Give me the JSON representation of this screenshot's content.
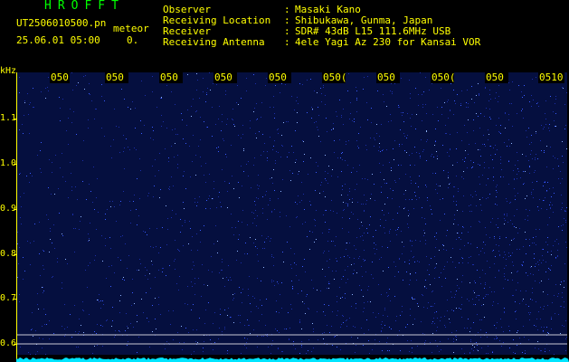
{
  "header": {
    "title": "HROFFT",
    "filename": "UT2506010500.pn",
    "meteor_label": "meteor",
    "datetime": "25.06.01 05:00",
    "count": "0."
  },
  "meta": [
    {
      "label": "Observer",
      "sep": ":",
      "value": "Masaki Kano"
    },
    {
      "label": "Receiving Location",
      "sep": ":",
      "value": "Shibukawa, Gunma, Japan"
    },
    {
      "label": "Receiver",
      "sep": ":",
      "value": "SDR# 43dB L15 111.6MHz USB"
    },
    {
      "label": "Receiving Antenna",
      "sep": ":",
      "value": "4ele Yagi Az 230 for Kansai VOR"
    }
  ],
  "time_labels": [
    "050",
    "050",
    "050",
    "050",
    "050",
    "050(",
    "050",
    "050(",
    "050",
    "0510"
  ],
  "y_axis": {
    "unit": "kHz",
    "ticks": [
      "1.1",
      "1.0",
      "0.9",
      "0.8",
      "0.7",
      "0.6"
    ]
  },
  "colors": {
    "background": "#000000",
    "text": "#ffff00",
    "title": "#00ff00",
    "spectrogram": "#0a1a5c",
    "noise": "#2a48ff",
    "baseline": "#00e5ff"
  }
}
